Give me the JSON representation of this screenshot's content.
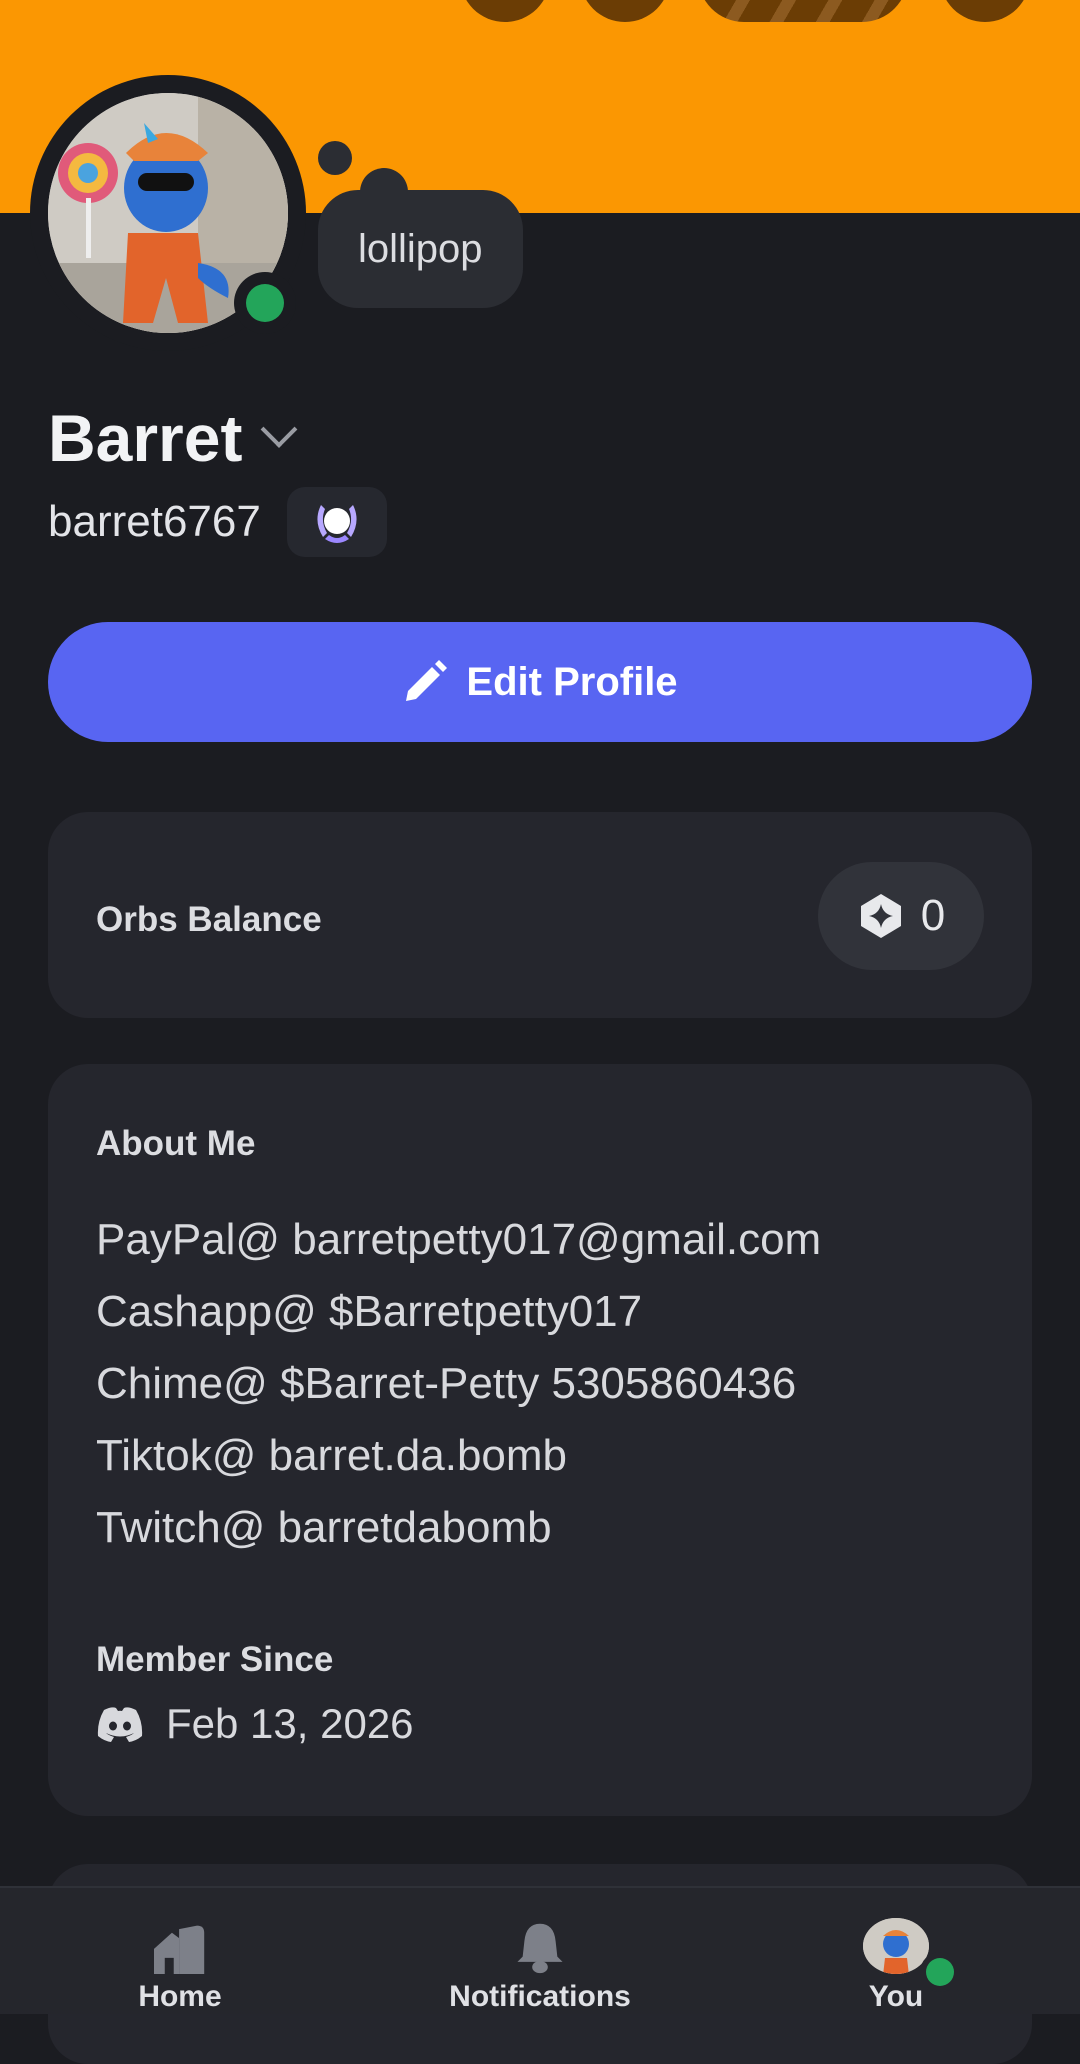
{
  "profile": {
    "display_name": "Barret",
    "username": "barret6767",
    "custom_status": "lollipop",
    "online_status": "online"
  },
  "actions": {
    "edit_profile_label": "Edit Profile"
  },
  "orbs": {
    "label": "Orbs Balance",
    "balance": "0"
  },
  "about": {
    "title": "About Me",
    "lines": [
      "PayPal@ barretpetty017@gmail.com",
      "Cashapp@ $Barretpetty017",
      "Chime@ $Barret-Petty 5305860436",
      "Tiktok@ barret.da.bomb",
      "Twitch@ barretdabomb"
    ]
  },
  "member_since": {
    "title": "Member Since",
    "date": "Feb 13, 2026"
  },
  "nav": {
    "home_label": "Home",
    "notifications_label": "Notifications",
    "you_label": "You"
  },
  "colors": {
    "banner": "#fb9702",
    "accent": "#5865f2",
    "online": "#23a55a",
    "background": "#1b1c21",
    "card": "#25262d"
  },
  "icons": {
    "badge": "nitro-laurel-icon",
    "edit": "pencil-icon",
    "orbs": "orb-icon",
    "member_since": "discord-logo-icon",
    "home": "home-icon",
    "notifications": "bell-icon"
  }
}
